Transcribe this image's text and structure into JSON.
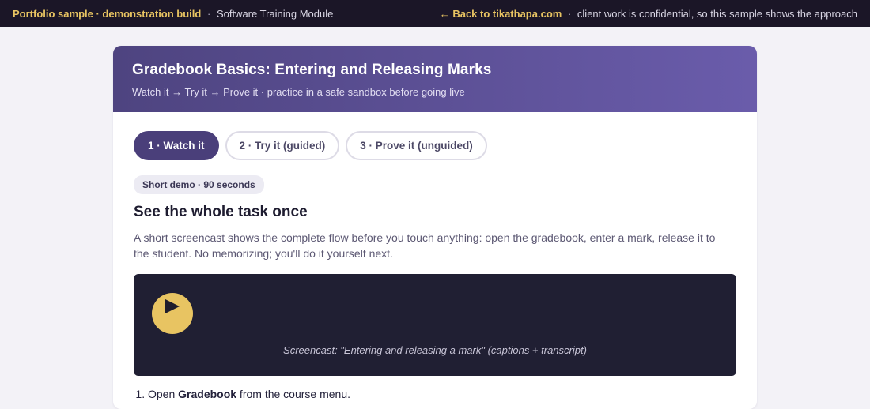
{
  "topbar": {
    "portfolio_label": "Portfolio sample · demonstration build",
    "separator": "·",
    "module_label": "Software Training Module",
    "back_link": "← Back to tikathapa.com",
    "note": "client work is confidential, so this sample shows the approach"
  },
  "hero": {
    "title": "Gradebook Basics: Entering and Releasing Marks",
    "subtitle": "Watch it → Try it → Prove it · practice in a safe sandbox before going live"
  },
  "tabs": [
    {
      "label": "1 · Watch it",
      "active": true
    },
    {
      "label": "2 · Try it (guided)",
      "active": false
    },
    {
      "label": "3 · Prove it (unguided)",
      "active": false
    }
  ],
  "section": {
    "badge": "Short demo · 90 seconds",
    "heading": "See the whole task once",
    "description": "A short screencast shows the complete flow before you touch anything: open the gradebook, enter a mark, release it to the student. No memorizing; you'll do it yourself next."
  },
  "video": {
    "play_icon": "play-icon",
    "caption": "Screencast: \"Entering and releasing a mark\" (captions + transcript)"
  },
  "steps": [
    {
      "prefix": "Open ",
      "bold": "Gradebook",
      "suffix": " from the course menu."
    }
  ],
  "colors": {
    "topbar_bg": "#1b1627",
    "accent": "#e8c462",
    "hero_start": "#4e4480",
    "hero_end": "#6a5cab",
    "active_tab": "#4a3f7a",
    "video_bg": "#201f33"
  }
}
